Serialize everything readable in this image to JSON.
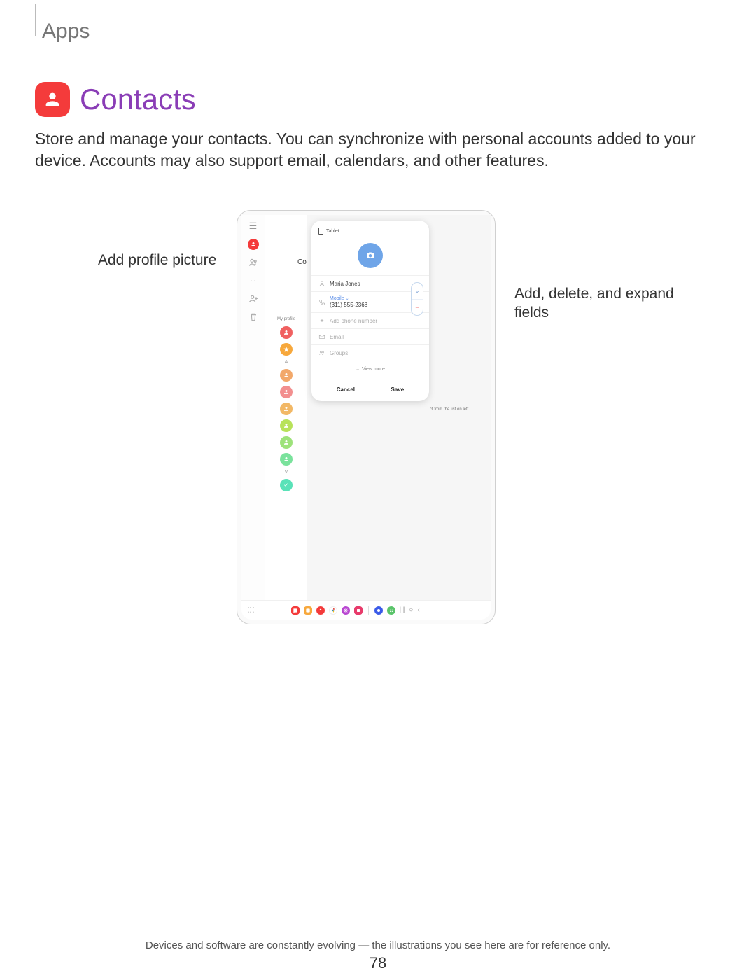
{
  "breadcrumb": "Apps",
  "title": "Contacts",
  "intro": "Store and manage your contacts. You can synchronize with personal accounts added to your device. Accounts may also support email, calendars, and other features.",
  "callouts": {
    "left": "Add profile picture",
    "right": "Add, delete, and expand fields"
  },
  "device": {
    "card": {
      "header_device": "Tablet",
      "name_value": "Maria Jones",
      "phone_type": "Mobile",
      "phone_value": "(311) 555-2368",
      "add_phone": "Add phone number",
      "email_placeholder": "Email",
      "groups_placeholder": "Groups",
      "view_more": "View more",
      "cancel": "Cancel",
      "save": "Save"
    },
    "side": {
      "my_profile": "My profile",
      "letter": "A",
      "letter2": "V"
    },
    "right_hint": "ct from the list on  left.",
    "main_partial": "Co"
  },
  "footer": "Devices and software are constantly evolving — the illustrations you see here are for reference only.",
  "page_number": "78"
}
